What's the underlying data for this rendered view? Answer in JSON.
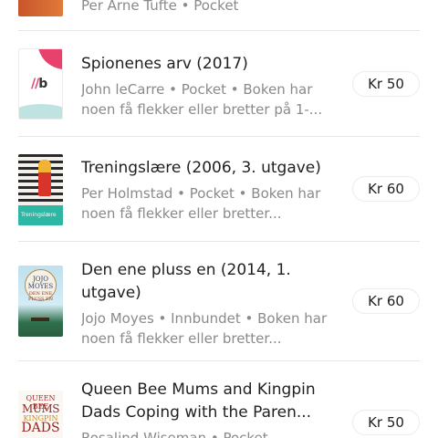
{
  "listings": [
    {
      "title": "",
      "subtitle": "Per Arne Tufte • Pocket",
      "price": ""
    },
    {
      "title": "Spionenes arv (2017)",
      "subtitle": "John leCarre • Pocket • Boken har noen få flekker eller bretter på 1-...",
      "price": "Kr 50",
      "cover_text": "b"
    },
    {
      "title": "Treningslære (2006, 3. utgave)",
      "subtitle": "Per Holmstad • Pocket • Boken har noen få flekker eller bretter...",
      "price": "Kr 60",
      "cover_text": "Treningslære"
    },
    {
      "title": "Den ene pluss en (2014, 1. utgave)",
      "subtitle": "Jojo Moyes • Innbundet • Boken har noen få flekker eller bretter...",
      "price": "Kr 60",
      "cover_author": "JOJO",
      "cover_author2": "MOYES",
      "cover_title": "DEN ENE PLUSS EN"
    },
    {
      "title": "Queen Bee Mums and Kingpin Dads Coping with the Paren...",
      "subtitle": "Rosalind Wiseman • Pocket",
      "price": "Kr 50",
      "cover_line1": "QUEEN BEE",
      "cover_line2": "MUMS",
      "cover_line3": "KINGPIN",
      "cover_line4": "DADS"
    }
  ],
  "colors": {
    "title": "#1f1f1f",
    "subtitle": "#8a8a8a",
    "divider": "#e6e6e6",
    "price_border": "#ececec"
  }
}
